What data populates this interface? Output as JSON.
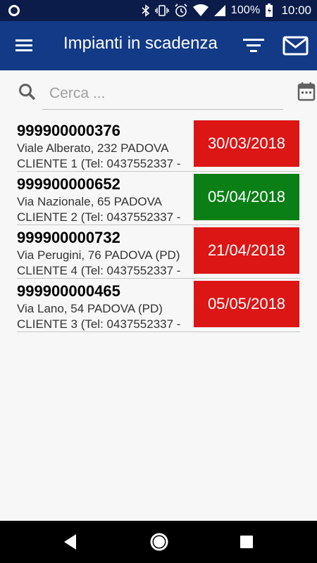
{
  "status_bar": {
    "battery": "100%",
    "time": "10:00"
  },
  "app_bar": {
    "title": "Impianti in scadenza"
  },
  "search": {
    "placeholder": "Cerca ..."
  },
  "colors": {
    "overdue": "#dc1515",
    "ok": "#0a7f16",
    "app_bar": "#123a86",
    "status_bar": "#0b1c4a"
  },
  "items": [
    {
      "code": "999900000376",
      "address": "Viale Alberato, 232 PADOVA",
      "client": "CLIENTE 1 (Tel: 0437552337 -",
      "date": "30/03/2018",
      "status": "overdue"
    },
    {
      "code": "999900000652",
      "address": "Via Nazionale, 65 PADOVA",
      "client": "CLIENTE 2 (Tel: 0437552337 -",
      "date": "05/04/2018",
      "status": "ok"
    },
    {
      "code": "999900000732",
      "address": "Via Perugini, 76 PADOVA (PD)",
      "client": "CLIENTE 4 (Tel: 0437552337 -",
      "date": "21/04/2018",
      "status": "overdue"
    },
    {
      "code": "999900000465",
      "address": "Via Lano, 54 PADOVA (PD)",
      "client": "CLIENTE 3 (Tel: 0437552337 -",
      "date": "05/05/2018",
      "status": "overdue"
    }
  ]
}
